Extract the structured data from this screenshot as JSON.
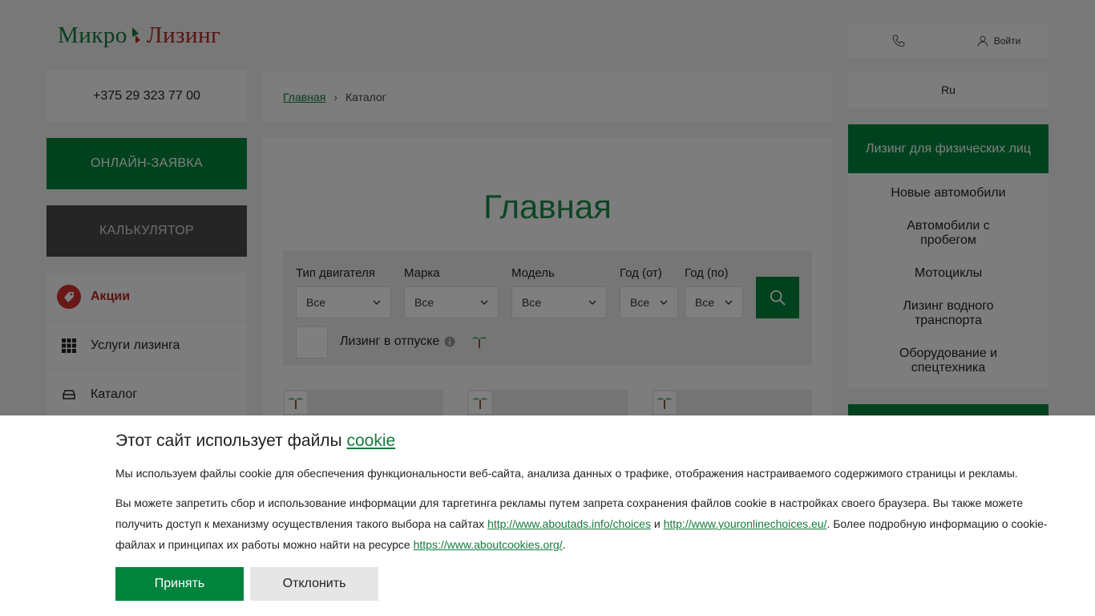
{
  "logo": {
    "part1": "Микро",
    "part2": "Лизинг"
  },
  "header": {
    "login_label": "Войти",
    "phone_icon": "phone-icon",
    "user_icon": "user-icon"
  },
  "left": {
    "phone": "+375 29 323 77 00",
    "online_button": "ОНЛАЙН-ЗАЯВКА",
    "calc_button": "КАЛЬКУЛЯТОР",
    "menu": [
      {
        "label": "Акции",
        "icon": "sale-tag-icon"
      },
      {
        "label": "Услуги лизинга",
        "icon": "grid-icon"
      },
      {
        "label": "Каталог",
        "icon": "car-icon"
      }
    ]
  },
  "breadcrumb": {
    "home": "Главная",
    "separator": "›",
    "current": "Каталог"
  },
  "main": {
    "title": "Главная"
  },
  "filters": {
    "engine_label": "Тип двигателя",
    "engine_value": "Все",
    "brand_label": "Марка",
    "brand_value": "Все",
    "model_label": "Модель",
    "model_value": "Все",
    "year_from_label": "Год (от)",
    "year_from_value": "Все",
    "year_to_label": "Год (по)",
    "year_to_value": "Все",
    "vacation_label": "Лизинг в отпуске"
  },
  "right": {
    "lang": "Ru",
    "menu_head": "Лизинг для физических лиц",
    "menu": [
      "Новые автомобили",
      "Автомобили с пробегом",
      "Мотоциклы",
      "Лизинг водного транспорта",
      "Оборудование и спецтехника"
    ]
  },
  "cookie": {
    "title": "Этот сайт использует файлы ",
    "title_link": "cookie",
    "p1": "Мы используем файлы cookie для обеспечения функциональности веб-сайта, анализа данных о трафике, отображения настраиваемого содержимого страницы и рекламы.",
    "p2_a": "Вы можете запретить сбор и использование информации для таргетинга рекламы путем запрета сохранения файлов cookie в настройках своего браузера. Вы также можете получить доступ к механизму осуществления такого выбора на сайтах ",
    "link1": "http://www.aboutads.info/choices",
    "p2_b": " и ",
    "link2": "http://www.youronlinechoices.eu/",
    "p2_c": ". Более подробную информацию о cookie-файлах и принципах их работы можно найти на ресурсе ",
    "link3": "https://www.aboutcookies.org/",
    "p2_d": ".",
    "accept": "Принять",
    "decline": "Отклонить"
  },
  "colors": {
    "brand_green": "#00843d",
    "brand_red": "#b3261e",
    "overlay": "rgba(0,0,0,0.5)"
  }
}
